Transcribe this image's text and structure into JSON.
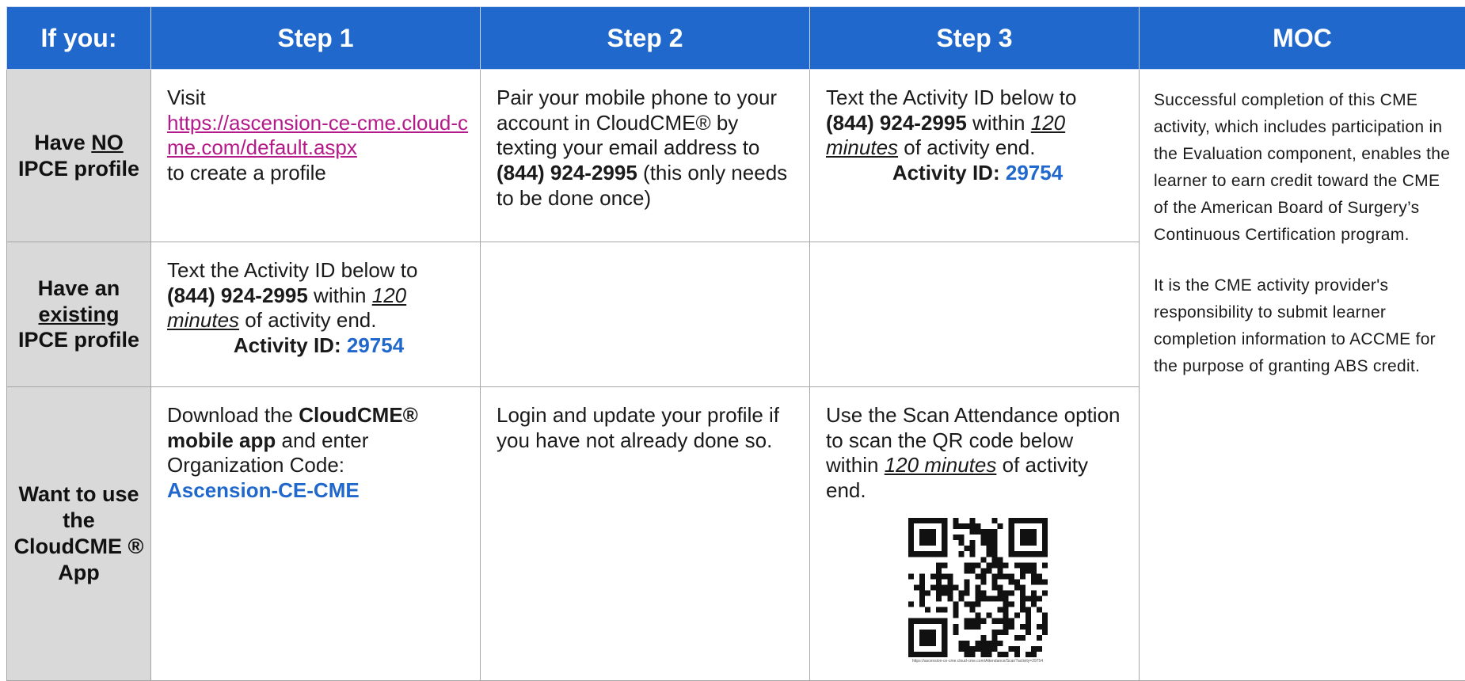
{
  "headers": {
    "col0": "If you:",
    "col1": "Step 1",
    "col2": "Step 2",
    "col3": "Step 3",
    "col4": "MOC"
  },
  "row1": {
    "label_pre": "Have ",
    "label_underlined": "NO",
    "label_post": "IPCE profile",
    "step1_text1": "Visit",
    "step1_link": "https://ascension-ce-cme.cloud-cme.com/default.aspx",
    "step1_text2": "to create a profile",
    "step2_text1": "Pair your mobile phone to your account in CloudCME® by texting your email address to",
    "step2_phone": "(844) 924-2995",
    "step2_text2": "(this only needs to be done once)",
    "step3_text1": "Text the Activity ID below to",
    "step3_phone": "(844) 924-2995",
    "step3_within": "within",
    "step3_minutes": "120 minutes",
    "step3_text2": "of activity end.",
    "step3_id_label": "Activity ID:",
    "step3_id_value": "29754"
  },
  "row2": {
    "label_pre": "Have an",
    "label_underlined": "existing",
    "label_post": "IPCE profile",
    "step1_text1": "Text the Activity ID below to",
    "step1_phone": "(844) 924-2995",
    "step1_within": "within",
    "step1_minutes": "120 minutes",
    "step1_text2": "of activity end.",
    "step1_id_label": "Activity ID:",
    "step1_id_value": "29754"
  },
  "row3": {
    "label": "Want to use the CloudCME ® App",
    "step1_text1": "Download the",
    "step1_bold": "CloudCME® mobile app",
    "step1_text2": "and enter Organization Code:",
    "step1_code": "Ascension-CE-CME",
    "step2_text": "Login and update your profile if you have not already done so.",
    "step3_text1": "Use the Scan Attendance option to scan the QR code below within",
    "step3_minutes": "120 minutes",
    "step3_text2": "of activity end.",
    "qr_caption": "https://ascension-ce-cme.cloud-cme.com/Attendance/Scan?activity=29754"
  },
  "moc": {
    "p1": "Successful completion of this CME activity, which includes participation in the Evaluation component, enables the learner to earn credit toward the CME of the American Board of Surgery’s Continuous Certification program.",
    "p2": "It is the CME activity provider's responsibility to submit learner completion information to ACCME for the purpose of granting ABS credit."
  },
  "colors": {
    "header_bg": "#2068cc",
    "label_bg": "#d9d9d9",
    "link": "#b51a8a",
    "accent_blue": "#2068cc"
  }
}
